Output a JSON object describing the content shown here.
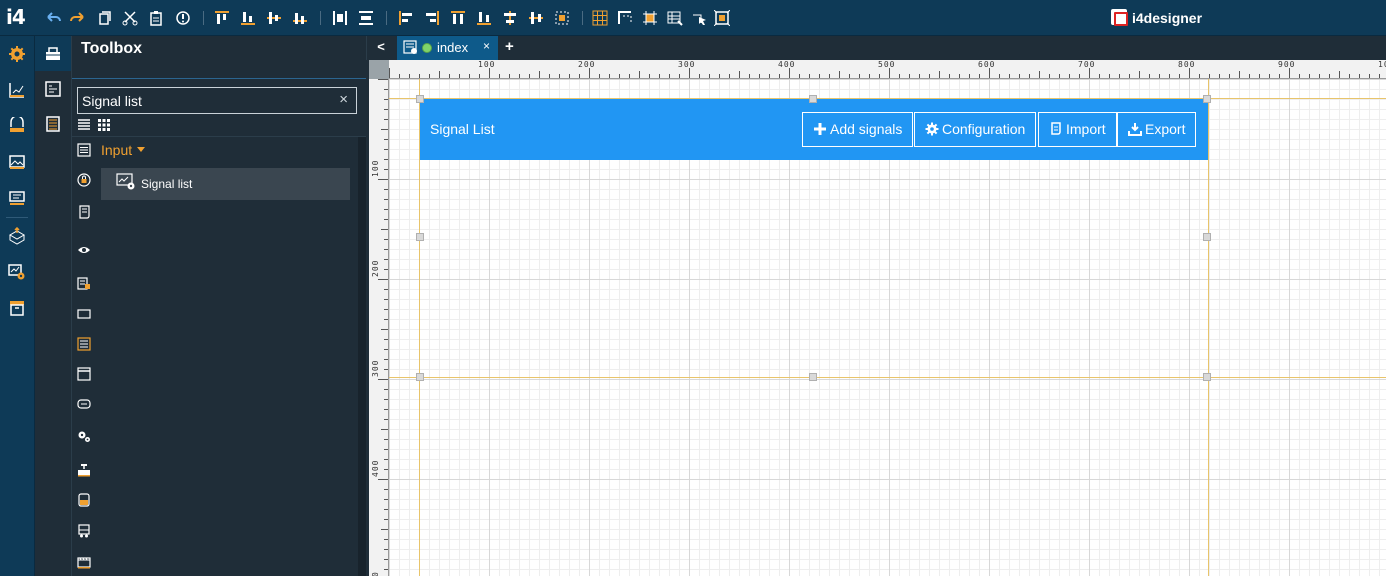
{
  "app": {
    "logo": "i4",
    "brand": "i4designer"
  },
  "toolbar": {
    "icons": [
      "undo-icon",
      "redo-icon",
      "copy-icon",
      "cut-icon",
      "paste-icon",
      "info-icon",
      "align-top-icon",
      "align-bottom-icon",
      "align-middle-icon",
      "align-baseline-icon",
      "distribute-horizontal-icon",
      "distribute-vertical-icon",
      "align-left-icon",
      "align-right-icon",
      "align-top-edge-icon",
      "align-bottom-edge-icon",
      "center-horizontal-icon",
      "center-vertical-icon",
      "fit-icon",
      "grid-icon",
      "snap-icon",
      "select-icon",
      "table-icon",
      "pointer-icon",
      "frame-icon"
    ]
  },
  "toolbox": {
    "title": "Toolbox",
    "search_value": "Signal list",
    "search_clear": "×",
    "group_label": "Input",
    "item_label": "Signal list"
  },
  "tabs": {
    "back": "<",
    "active_label": "index",
    "close": "×",
    "add": "+"
  },
  "rulers": {
    "top_labels": [
      "100",
      "200",
      "300",
      "400",
      "500",
      "600",
      "700",
      "800",
      "900",
      "10"
    ],
    "left_labels": [
      "100",
      "200",
      "300",
      "400",
      "0"
    ]
  },
  "widget": {
    "title": "Signal List",
    "buttons": [
      {
        "label": "Add signals",
        "icon": "plus-icon"
      },
      {
        "label": "Configuration",
        "icon": "gear-icon"
      },
      {
        "label": "Import",
        "icon": "import-icon"
      },
      {
        "label": "Export",
        "icon": "download-icon"
      }
    ]
  },
  "colors": {
    "topbar": "#0e3a57",
    "panel": "#1f2d38",
    "accent": "#2196f3",
    "group_label": "#f0a030",
    "guide": "#e8c46a"
  }
}
